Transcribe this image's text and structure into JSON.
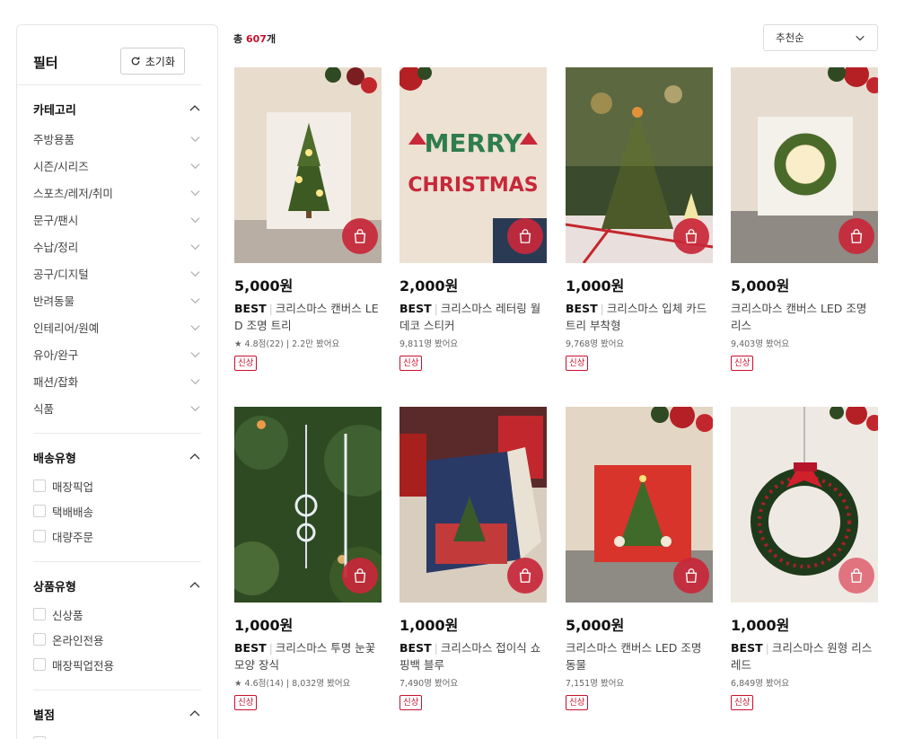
{
  "sidebar": {
    "title": "필터",
    "reset_label": "초기화",
    "category": {
      "title": "카테고리",
      "items": [
        "주방용품",
        "시즌/시리즈",
        "스포츠/레저/취미",
        "문구/팬시",
        "수납/정리",
        "공구/디지털",
        "반려동물",
        "인테리어/원예",
        "유아/완구",
        "패션/잡화",
        "식품"
      ]
    },
    "delivery": {
      "title": "배송유형",
      "items": [
        "매장픽업",
        "택배배송",
        "대량주문"
      ]
    },
    "product_type": {
      "title": "상품유형",
      "items": [
        "신상품",
        "온라인전용",
        "매장픽업전용"
      ]
    },
    "rating": {
      "title": "별점"
    }
  },
  "toolbar": {
    "count_prefix": "총",
    "count_value": "607",
    "count_suffix": "개",
    "sort_label": "추천순"
  },
  "products": [
    {
      "price": "5,000원",
      "best": "BEST",
      "name": "크리스마스 캔버스 LED 조명 트리",
      "meta": "★ 4.8점(22) | 2.2만 봤어요",
      "badge": "신상"
    },
    {
      "price": "2,000원",
      "best": "BEST",
      "name": "크리스마스 레터링 월데코 스티커",
      "meta": "9,811명 봤어요",
      "badge": "신상"
    },
    {
      "price": "1,000원",
      "best": "BEST",
      "name": "크리스마스 입체 카드 트리 부착형",
      "meta": "9,768명 봤어요",
      "badge": "신상"
    },
    {
      "price": "5,000원",
      "best": "",
      "name": "크리스마스 캔버스 LED 조명 리스",
      "meta": "9,403명 봤어요",
      "badge": "신상"
    },
    {
      "price": "1,000원",
      "best": "BEST",
      "name": "크리스마스 투명 눈꽃 모양 장식",
      "meta": "★ 4.6점(14) | 8,032명 봤어요",
      "badge": "신상"
    },
    {
      "price": "1,000원",
      "best": "BEST",
      "name": "크리스마스 접이식 쇼핑백 블루",
      "meta": "7,490명 봤어요",
      "badge": "신상"
    },
    {
      "price": "5,000원",
      "best": "",
      "name": "크리스마스 캔버스 LED 조명 동물",
      "meta": "7,151명 봤어요",
      "badge": "신상"
    },
    {
      "price": "1,000원",
      "best": "BEST",
      "name": "크리스마스 원형 리스 레드",
      "meta": "6,849명 봤어요",
      "badge": "신상"
    }
  ],
  "product_image_text": {
    "merry": "MERRY",
    "christmas": "CHRISTMAS"
  },
  "colors": {
    "accent": "#c8102e",
    "cart_button": "#c8283a"
  }
}
